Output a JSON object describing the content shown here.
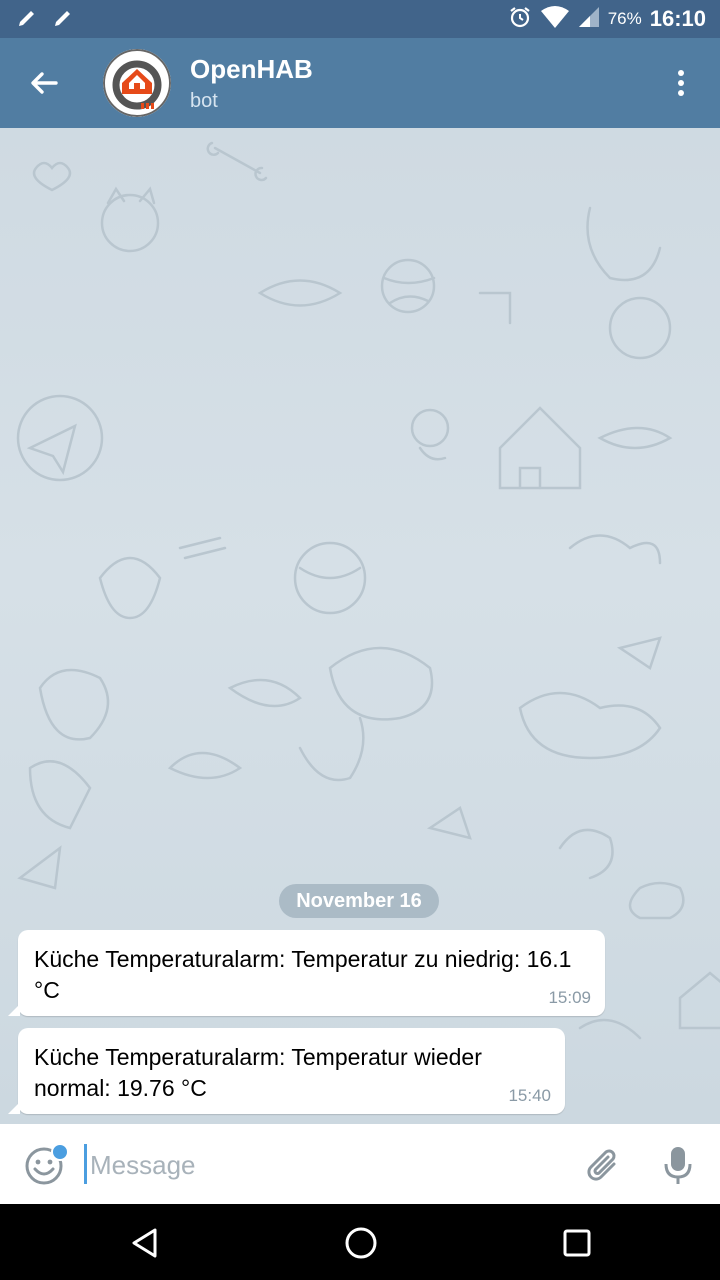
{
  "status_bar": {
    "battery": "76%",
    "time": "16:10",
    "icons": [
      "pencil-icon",
      "pencil-icon",
      "alarm-icon",
      "wifi-icon",
      "signal-icon",
      "battery-icon"
    ]
  },
  "header": {
    "title": "OpenHAB",
    "subtitle": "bot",
    "icons": [
      "arrow-back-icon",
      "openhab-logo",
      "more-vert-icon"
    ]
  },
  "chat": {
    "date_separator": "November 16",
    "messages": [
      {
        "text": "Küche Temperaturalarm: Temperatur zu niedrig: 16.1 °C",
        "time": "15:09"
      },
      {
        "text": "Küche Temperaturalarm: Temperatur wieder normal: 19.76 °C",
        "time": "15:40"
      }
    ]
  },
  "composer": {
    "placeholder": "Message",
    "value": "",
    "icons": [
      "emoji-icon",
      "attach-icon",
      "mic-icon"
    ]
  },
  "colors": {
    "status_bar": "#41648a",
    "app_bar": "#517da2",
    "accent": "#4b9ee0",
    "chat_background": "#cdd8e0"
  }
}
